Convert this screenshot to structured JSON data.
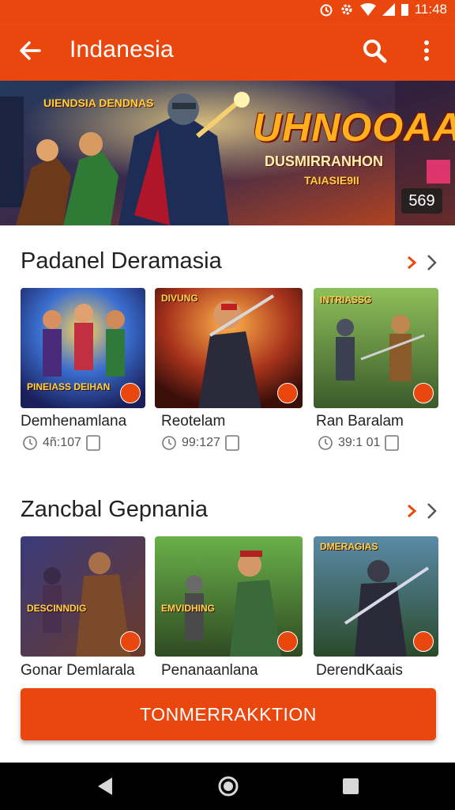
{
  "status_bar": {
    "time": "11:48"
  },
  "app_bar": {
    "title": "Indanesia"
  },
  "banner": {
    "title": "UHNOOAA",
    "subtitle": "DUSMIRRANHON",
    "tagline": "TAIASIE9II",
    "left_title": "UIENDSIA DENDNAS",
    "count": "569"
  },
  "sections": [
    {
      "title": "Padanel Deramasia",
      "items": [
        {
          "name": "Demhenamlana",
          "image_text": "PINEIASS DEIHAN",
          "meta": "4ñ:107"
        },
        {
          "name": "Reotelam",
          "image_text": "DIVUNG",
          "meta": "99:127"
        },
        {
          "name": "Ran Baralam",
          "image_text": "INTRIASSG",
          "meta": "39:1 01"
        }
      ]
    },
    {
      "title": "Zancbal Gepnania",
      "items": [
        {
          "name": "Gonar Demlarala",
          "image_text": "DESCINNDIG",
          "meta": ""
        },
        {
          "name": "Penanaanlana",
          "image_text": "EMVIDHING",
          "meta": ""
        },
        {
          "name": "DerendKaais",
          "image_text": "DMERAGIAS",
          "meta": ""
        }
      ]
    }
  ],
  "cta": {
    "label": "TONMERRAKKTION"
  },
  "colors": {
    "accent": "#e9470e"
  },
  "icons": [
    "alarm-icon",
    "settings-icon",
    "wifi-icon",
    "signal-icon",
    "battery-icon",
    "back-arrow-icon",
    "search-icon",
    "more-vert-icon",
    "chevron-right-icon",
    "play-icon",
    "clock-icon",
    "bookmark-icon",
    "nav-back-icon",
    "nav-home-icon",
    "nav-recents-icon"
  ]
}
